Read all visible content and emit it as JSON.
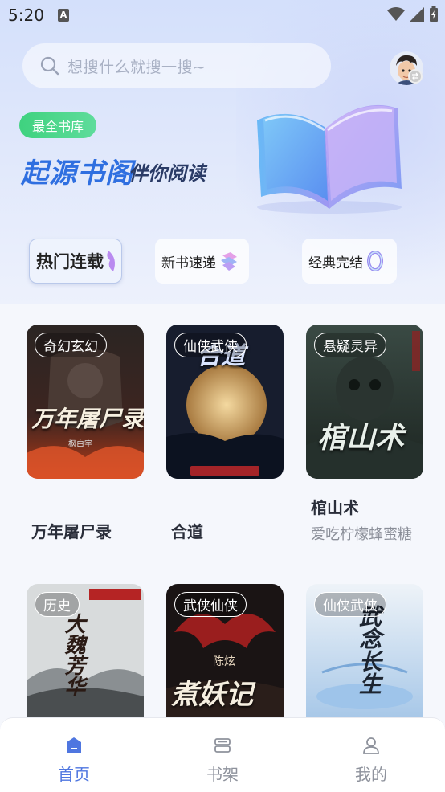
{
  "status_bar": {
    "time": "5:20",
    "notification_letter": "A"
  },
  "search": {
    "placeholder": "想搜什么就搜一搜~"
  },
  "banner": {
    "badge": "最全书库",
    "brand": "起源书阁",
    "slogan": "伴你阅读"
  },
  "categories": [
    {
      "label": "热门连载",
      "active": true
    },
    {
      "label": "新书速递",
      "active": false
    },
    {
      "label": "经典完结",
      "active": false
    }
  ],
  "books": [
    {
      "tag": "奇幻玄幻",
      "cover_title": "万年屠尸录",
      "cover_author": "枫白宇",
      "title": "万年屠尸录",
      "author": ""
    },
    {
      "tag": "仙侠武侠",
      "cover_title": "合道",
      "cover_author": "",
      "title": "合道",
      "author": ""
    },
    {
      "tag": "悬疑灵异",
      "cover_title": "棺山术",
      "cover_author": "",
      "title": "棺山术",
      "author": "爱吃柠檬蜂蜜糖"
    },
    {
      "tag": "历史",
      "cover_title": "大魏芳华",
      "cover_author": "",
      "title": "",
      "author": ""
    },
    {
      "tag": "武侠仙侠",
      "cover_title": "煮妖记",
      "cover_author": "陈炫",
      "title": "",
      "author": ""
    },
    {
      "tag": "仙侠武侠",
      "cover_title": "武念长生",
      "cover_author": "",
      "title": "",
      "author": ""
    }
  ],
  "bottom_nav": [
    {
      "label": "首页",
      "icon": "home-icon",
      "active": true
    },
    {
      "label": "书架",
      "icon": "bookshelf-icon",
      "active": false
    },
    {
      "label": "我的",
      "icon": "profile-icon",
      "active": false
    }
  ],
  "colors": {
    "accent": "#4f76e0",
    "brand_blue": "#2f6fe0",
    "badge_green": "#3fd27f"
  }
}
